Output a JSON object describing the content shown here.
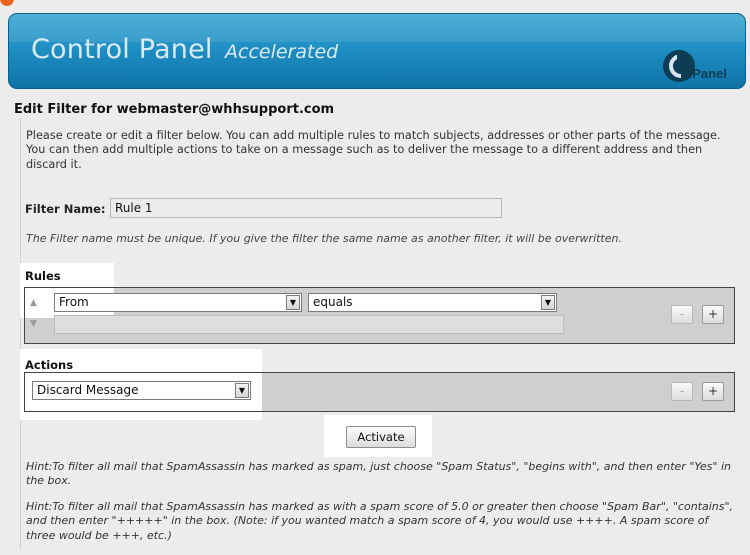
{
  "header": {
    "title": "Control Panel",
    "subtitle": "Accelerated",
    "logo_text": "cPanel"
  },
  "page": {
    "heading": "Edit Filter for webmaster@whhsupport.com",
    "intro": "Please create or edit a filter below. You can add multiple rules to match subjects, addresses or other parts of the message. You can then add multiple actions to take on a message such as to deliver the message to a different address and then discard it."
  },
  "filter_name": {
    "label": "Filter Name:",
    "value": "Rule 1",
    "note": "The Filter name must be unique. If you give the filter the same name as another filter, it will be overwritten."
  },
  "rules": {
    "label": "Rules",
    "field_selected": "From",
    "operator_selected": "equals",
    "value": "",
    "remove_label": "-",
    "add_label": "+"
  },
  "actions": {
    "label": "Actions",
    "action_selected": "Discard Message",
    "remove_label": "-",
    "add_label": "+"
  },
  "activate_label": "Activate",
  "hints": [
    "Hint:To filter all mail that SpamAssassin has marked as spam, just choose \"Spam Status\", \"begins with\", and then enter \"Yes\" in the box.",
    "Hint:To filter all mail that SpamAssassin has marked as with a spam score of 5.0 or greater then choose \"Spam Bar\", \"contains\", and then enter \"+++++\" in the box. (Note: if you wanted match a spam score of 4, you would use ++++. A spam score of three would be +++, etc.)"
  ],
  "colors": {
    "banner": "#1f8fc4",
    "highlight": "#ffffff",
    "box_fill": "#cfcfcf"
  }
}
